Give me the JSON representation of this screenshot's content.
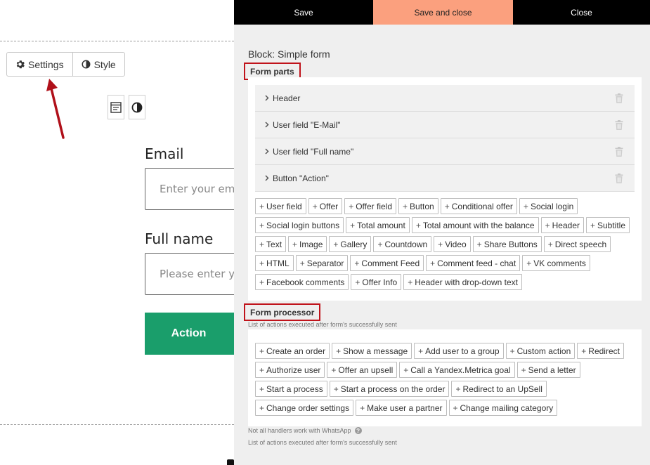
{
  "toolbar": {
    "settings_label": "Settings",
    "style_label": "Style"
  },
  "form_preview": {
    "email_label": "Email",
    "email_placeholder": "Enter your email",
    "fullname_label": "Full name",
    "fullname_placeholder": "Please enter your full name",
    "action_label": "Action"
  },
  "panel": {
    "save_label": "Save",
    "save_close_label": "Save and close",
    "close_label": "Close",
    "block_title": "Block: Simple form",
    "form_parts_title": "Form parts",
    "parts": [
      {
        "label": "Header"
      },
      {
        "label": "User field \"E-Mail\""
      },
      {
        "label": "User field \"Full name\""
      },
      {
        "label": "Button \"Action\""
      }
    ],
    "add_parts": [
      "User field",
      "Offer",
      "Offer field",
      "Button",
      "Conditional offer",
      "Social login",
      "Social login buttons",
      "Total amount",
      "Total amount with the balance",
      "Header",
      "Subtitle",
      "Text",
      "Image",
      "Gallery",
      "Countdown",
      "Video",
      "Share Buttons",
      "Direct speech",
      "HTML",
      "Separator",
      "Comment Feed",
      "Comment feed - chat",
      "VK comments",
      "Facebook comments",
      "Offer Info",
      "Header with drop-down text"
    ],
    "form_processor_title": "Form processor",
    "processor_subtitle": "List of actions executed after form's successfully sent",
    "add_actions": [
      "Create an order",
      "Show a message",
      "Add user to a group",
      "Custom action",
      "Redirect",
      "Authorize user",
      "Offer an upsell",
      "Call a Yandex.Metrica goal",
      "Send a letter",
      "Start a process",
      "Start a process on the order",
      "Redirect to an UpSell",
      "Change order settings",
      "Make user a partner",
      "Change mailing category"
    ],
    "footnote": "Not all handlers work with WhatsApp",
    "footnote2": "List of actions executed after form's successfully sent"
  },
  "colors": {
    "accent": "#fba07e",
    "action_button": "#1a9e6b",
    "highlight_border": "#c0131b",
    "arrow": "#b0101a"
  },
  "icons": {
    "settings": "gear-icon",
    "style": "contrast-icon",
    "part_expand": "chevron-right-icon",
    "part_delete": "trash-icon",
    "help": "question-icon"
  }
}
